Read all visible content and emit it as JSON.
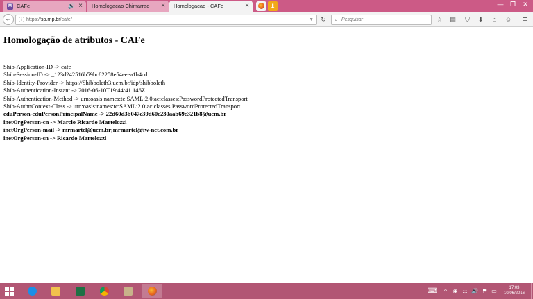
{
  "colors": {
    "tab_strip": "#cc5a86",
    "taskbar": "#b25674",
    "active_tab": "#f3f3f3"
  },
  "browser": {
    "tabs": [
      {
        "label": "CAFe",
        "favicon": "M",
        "has_audio_icon": true,
        "active": false
      },
      {
        "label": "Homologacao Chimarrao",
        "active": false
      },
      {
        "label": "Homologacao - CAFe",
        "active": true
      }
    ],
    "close_glyph": "×",
    "audio_glyph": "🔊",
    "window_controls": {
      "minimize": "—",
      "restore": "❐",
      "close": "✕"
    },
    "nav": {
      "back_glyph": "←",
      "url_host": "sp.rnp.br",
      "url_prefix": "https://",
      "url_path": "/cafe/",
      "reload_glyph": "↻",
      "search_glyph": "⌕",
      "search_placeholder": "Pesquisar",
      "toolbar_icons": [
        "star-icon",
        "reading-list-icon",
        "pocket-icon",
        "download-icon",
        "home-icon",
        "chat-icon",
        "menu-icon"
      ],
      "toolbar_glyphs": {
        "star": "☆",
        "reading": "▤",
        "pocket": "⛉",
        "download": "⬇",
        "home": "⌂",
        "chat": "☺",
        "menu": "≡"
      }
    }
  },
  "page": {
    "title": "Homologação de atributos - CAFe",
    "attributes": [
      {
        "text": "Shib-Application-ID -> cafe",
        "bold": false
      },
      {
        "text": "Shib-Session-ID -> _123d242516b59bc82258e54eeea1b4cd",
        "bold": false
      },
      {
        "text": "Shib-Identity-Provider -> https://Shibboleth3.uem.br/idp/shibboleth",
        "bold": false
      },
      {
        "text": "Shib-Authentication-Instant -> 2016-06-10T19:44:41.146Z",
        "bold": false
      },
      {
        "text": "Shib-Authentication-Method -> urn:oasis:names:tc:SAML:2.0:ac:classes:PasswordProtectedTransport",
        "bold": false
      },
      {
        "text": "Shib-AuthnContext-Class -> urn:oasis:names:tc:SAML:2.0:ac:classes:PasswordProtectedTransport",
        "bold": false
      },
      {
        "text": "eduPerson-eduPersonPrincipalName -> 22d60d3b047c39d60c230aab69c321b8@uem.br",
        "bold": true
      },
      {
        "text": "inetOrgPerson-cn -> Marcio Ricardo Martelozzi",
        "bold": true
      },
      {
        "text": "inetOrgPerson-mail -> mrmartel@uem.br;mrmartel@iw-net.com.br",
        "bold": true
      },
      {
        "text": "inetOrgPerson-sn -> Ricardo Martelozzi",
        "bold": true
      }
    ]
  },
  "taskbar": {
    "apps": [
      "windows-start",
      "internet-explorer",
      "file-explorer",
      "excel",
      "chrome",
      "archive-app",
      "firefox"
    ],
    "clock_time": "17:03",
    "clock_date": "10/06/2016",
    "tray_glyphs": {
      "keyboard": "⌨",
      "chevron": "^",
      "network": "☷",
      "volume": "🔊",
      "flag": "⚑"
    }
  }
}
